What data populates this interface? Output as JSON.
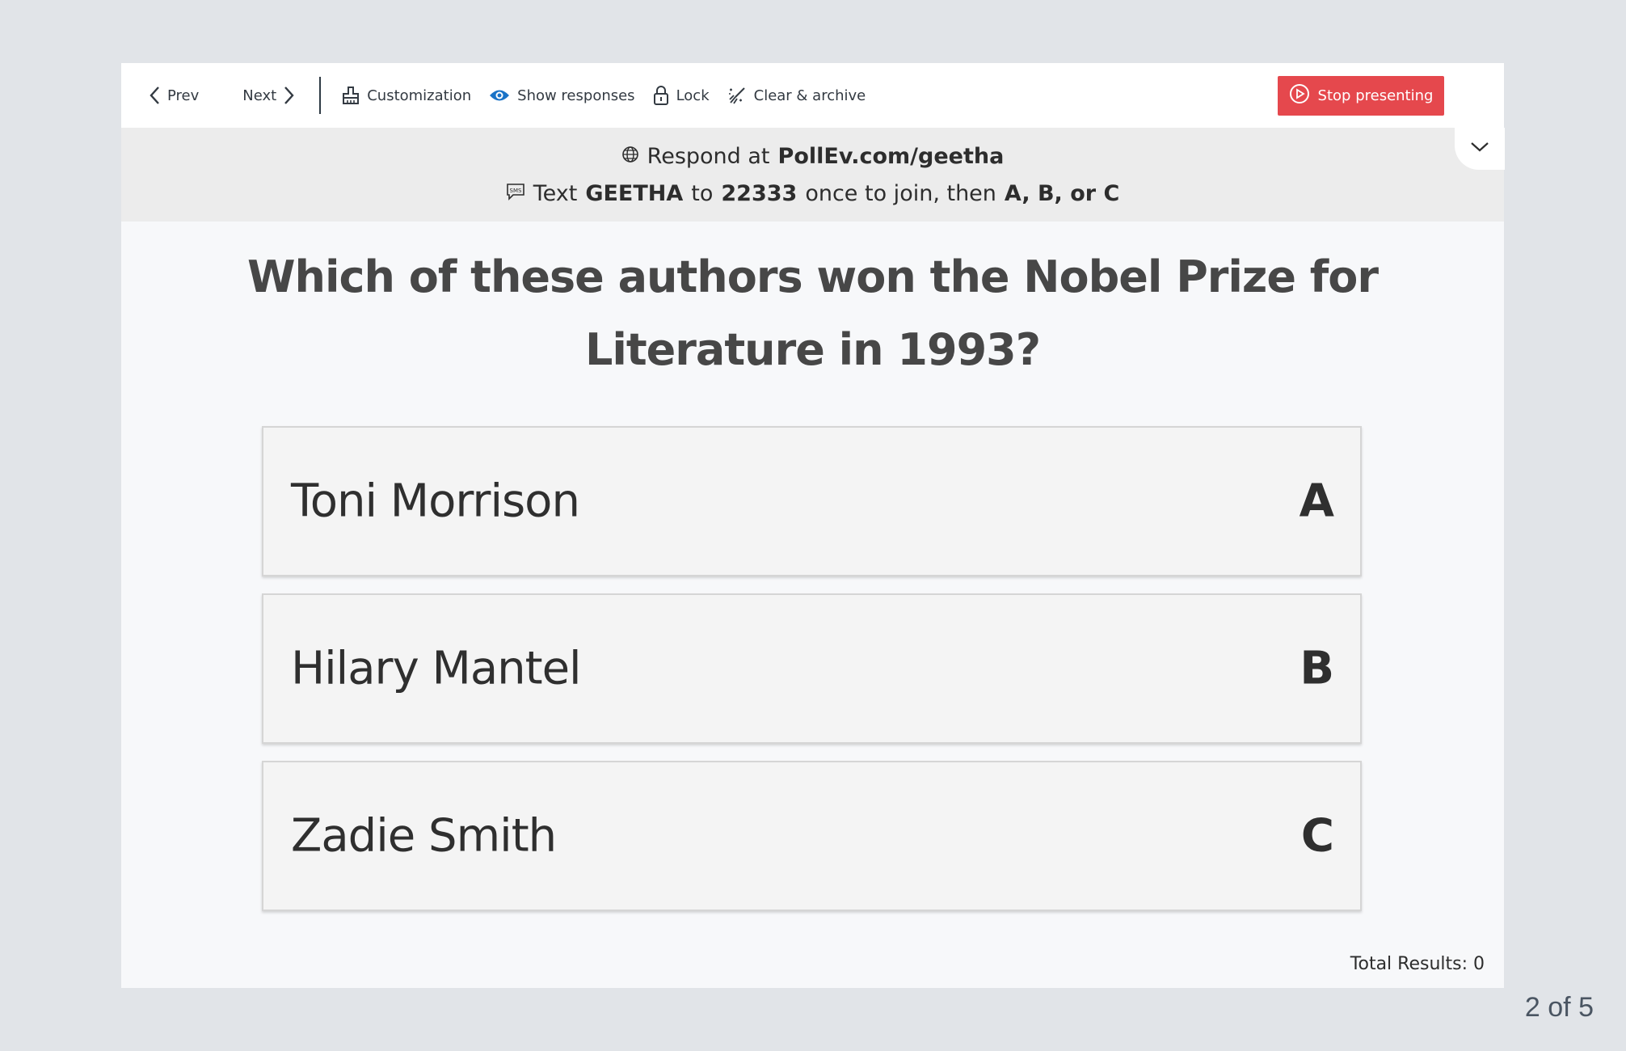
{
  "toolbar": {
    "prev": "Prev",
    "next": "Next",
    "customization": "Customization",
    "show_responses": "Show responses",
    "lock": "Lock",
    "clear_archive": "Clear & archive",
    "stop_presenting": "Stop presenting",
    "icons": [
      "chevron-left-icon",
      "chevron-right-icon",
      "paint-roller-icon",
      "eye-icon",
      "lock-icon",
      "clear-archive-icon",
      "play-circle-icon",
      "chevron-down-icon"
    ]
  },
  "respond": {
    "line1_prefix": "Respond at",
    "url": "PollEv.com/geetha",
    "line2_text": "Text",
    "keyword": "GEETHA",
    "to": "to",
    "number": "22333",
    "suffix": "once to join, then",
    "choices": "A, B, or C"
  },
  "question": "Which of these authors won the Nobel Prize for Literature in 1993?",
  "options": [
    {
      "label": "Toni Morrison",
      "key": "A"
    },
    {
      "label": "Hilary Mantel",
      "key": "B"
    },
    {
      "label": "Zadie Smith",
      "key": "C"
    }
  ],
  "total_results": "Total Results: 0",
  "pager": "2 of 5",
  "colors": {
    "accent_stop": "#e5484d",
    "eye_icon": "#1a73c7",
    "background": "#e1e4e8"
  }
}
